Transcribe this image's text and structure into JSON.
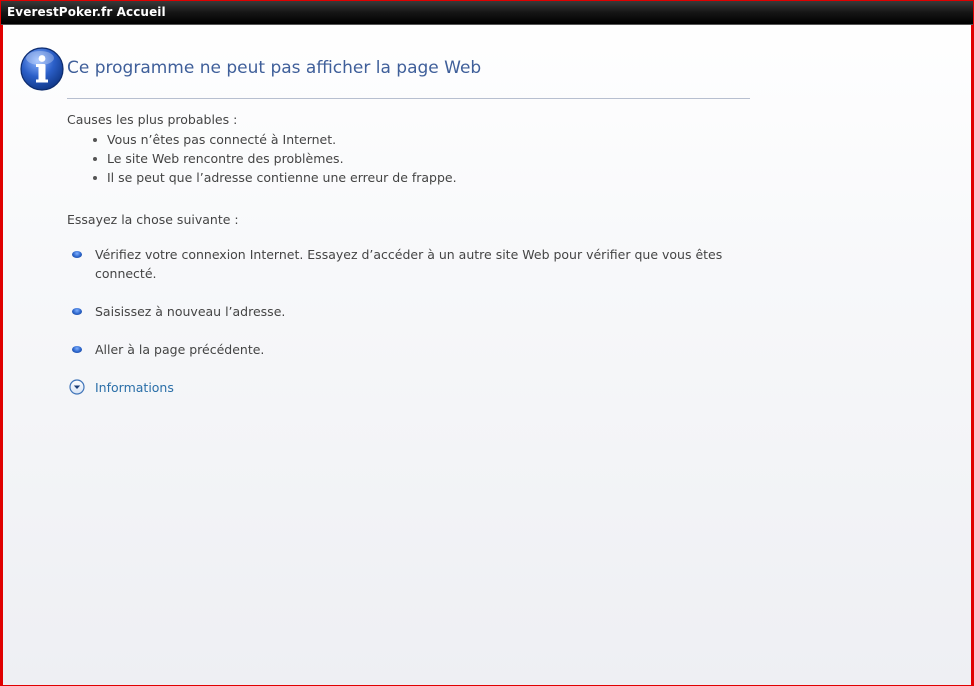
{
  "window": {
    "title": "EverestPoker.fr Accueil"
  },
  "page": {
    "title": "Ce programme ne peut pas afficher la page Web",
    "causes_heading": "Causes les plus probables :",
    "causes": [
      "Vous n’êtes pas connecté à Internet.",
      "Le site Web rencontre des problèmes.",
      "Il se peut que l’adresse contienne une erreur de frappe."
    ],
    "try_heading": "Essayez la chose suivante :",
    "suggestions": [
      "Vérifiez votre connexion Internet. Essayez d’accéder à un autre site Web pour vérifier que vous êtes connecté.",
      "Saisissez à nouveau l’adresse.",
      "Aller à la page précédente."
    ],
    "info_link": "Informations"
  },
  "icons": {
    "info": "info-icon",
    "expand": "chevron-down-circle-icon",
    "bullet": "blue-bullet-icon"
  },
  "colors": {
    "title": "#3f5f9a",
    "link": "#2a6fa8",
    "frame_border": "#e00000",
    "titlebar": "#000000"
  }
}
